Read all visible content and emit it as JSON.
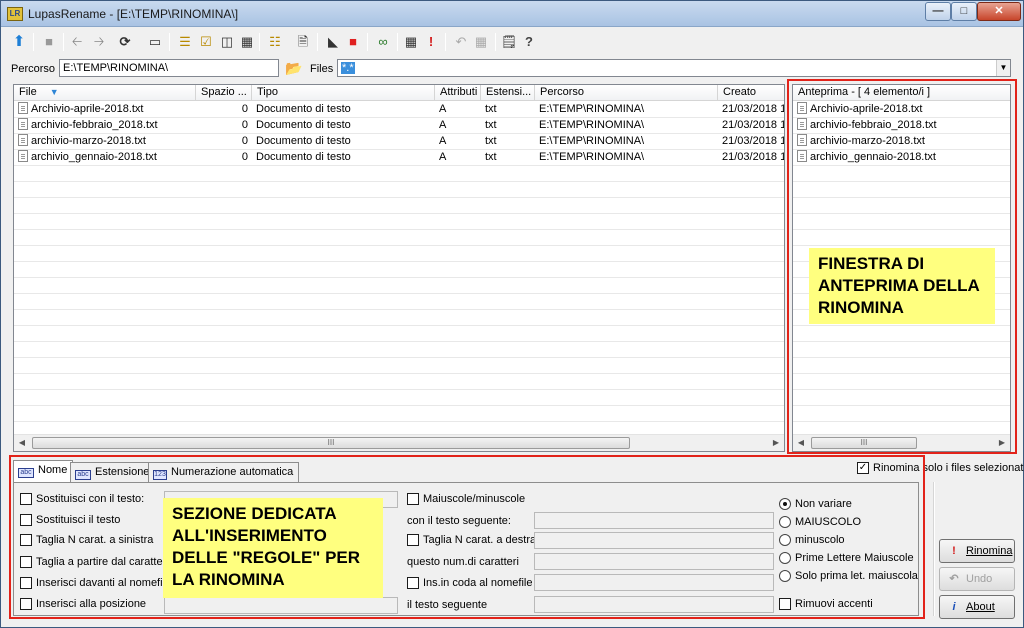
{
  "window": {
    "title": "LupasRename - [E:\\TEMP\\RINOMINA\\]",
    "app_icon": "LR",
    "minimize_icon": "minimize-icon",
    "maximize_icon": "maximize-icon",
    "close_icon": "close-icon"
  },
  "toolbar": {
    "icons": [
      "up-arrow-icon",
      "stop-icon",
      "back-icon",
      "forward-icon",
      "refresh-icon",
      "drive-icon",
      "select-all-icon",
      "select-list-icon",
      "columns-icon",
      "grid-icon",
      "tree-icon",
      "document-icon",
      "image-icon",
      "colors-icon",
      "binoculars-icon",
      "calculator-icon",
      "exclamation-icon",
      "undo-icon",
      "disabled-icon",
      "notes-icon",
      "help-icon"
    ]
  },
  "pathbar": {
    "percorso_label": "Percorso",
    "percorso_value": "E:\\TEMP\\RINOMINA\\",
    "files_label": "Files",
    "files_value": "*.*"
  },
  "filelist": {
    "columns": [
      "File",
      "Spazio ...",
      "Tipo",
      "Attributi",
      "Estensi...",
      "Percorso",
      "Creato"
    ],
    "rows": [
      {
        "file": "Archivio-aprile-2018.txt",
        "size": "0",
        "type": "Documento di testo",
        "attr": "A",
        "ext": "txt",
        "path": "E:\\TEMP\\RINOMINA\\",
        "created": "21/03/2018 1"
      },
      {
        "file": "archivio-febbraio_2018.txt",
        "size": "0",
        "type": "Documento di testo",
        "attr": "A",
        "ext": "txt",
        "path": "E:\\TEMP\\RINOMINA\\",
        "created": "21/03/2018 1"
      },
      {
        "file": "archivio-marzo-2018.txt",
        "size": "0",
        "type": "Documento di testo",
        "attr": "A",
        "ext": "txt",
        "path": "E:\\TEMP\\RINOMINA\\",
        "created": "21/03/2018 1"
      },
      {
        "file": "archivio_gennaio-2018.txt",
        "size": "0",
        "type": "Documento di testo",
        "attr": "A",
        "ext": "txt",
        "path": "E:\\TEMP\\RINOMINA\\",
        "created": "21/03/2018 1"
      }
    ],
    "scroll_grip": "III"
  },
  "preview": {
    "header": "Anteprima - [ 4 elemento/i ]",
    "items": [
      "Archivio-aprile-2018.txt",
      "archivio-febbraio_2018.txt",
      "archivio-marzo-2018.txt",
      "archivio_gennaio-2018.txt"
    ],
    "scroll_grip": "III"
  },
  "annotations": {
    "preview_note": "FINESTRA DI\nANTEPRIMA DELLA\nRINOMINA",
    "rules_note": "SEZIONE DEDICATA\nALL'INSERIMENTO\nDELLE \"REGOLE\" PER\nLA RINOMINA",
    "box_color": "#e2231a",
    "note_color": "#ffff7f"
  },
  "tabs": {
    "items": [
      {
        "label": "Nome",
        "icon": "abc-icon"
      },
      {
        "label": "Estensione",
        "icon": "abc-icon"
      },
      {
        "label": "Numerazione automatica",
        "icon": "123-icon"
      }
    ],
    "active": "Nome",
    "only_selected_label": "Rinomina solo i files selezionati",
    "only_selected_checked": true
  },
  "rules": {
    "col1": [
      "Sostituisci con il testo:",
      "Sostituisci il testo",
      "Taglia N carat. a sinistra",
      "Taglia a partire dal carattere",
      "Inserisci davanti al nomefile",
      "Inserisci alla posizione"
    ],
    "maiuscole_label": "Maiuscole/minuscole",
    "con_testo_label": "con il testo seguente:",
    "taglia_destra_label": "Taglia N carat. a destra",
    "num_caratteri_label": "questo num.di caratteri",
    "ins_coda_label": "Ins.in coda al nomefile",
    "testo_seguente_label": "il testo seguente",
    "case_options": [
      "Non variare",
      "MAIUSCOLO",
      "minuscolo",
      "Prime Lettere Maiuscole",
      "Solo prima let. maiuscola"
    ],
    "case_selected": "Non variare",
    "rimuovi_accenti_label": "Rimuovi accenti"
  },
  "buttons": {
    "rinomina": "Rinomina",
    "undo": "Undo",
    "about": "About"
  }
}
